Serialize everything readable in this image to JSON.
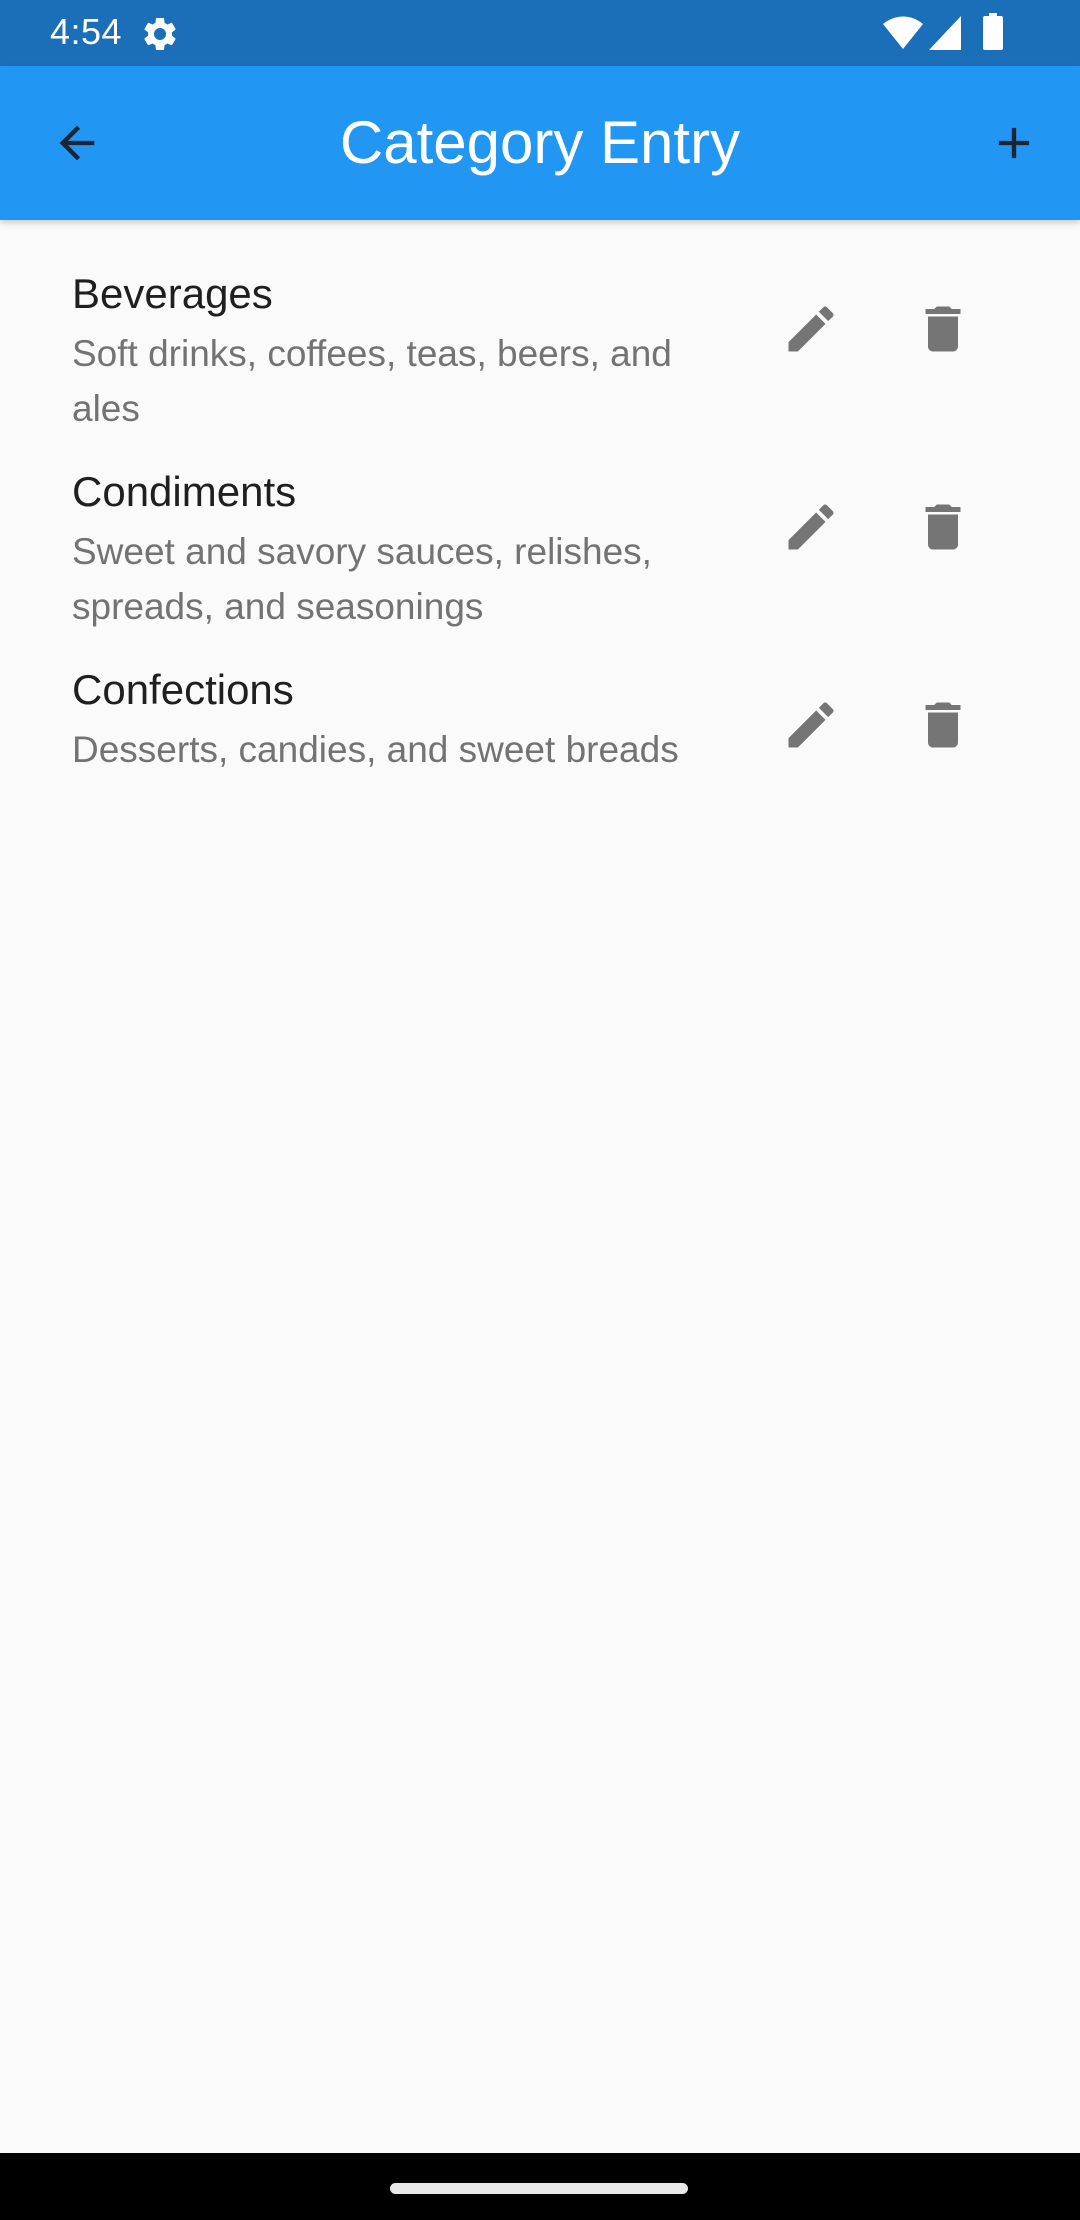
{
  "status_bar": {
    "time": "4:54",
    "icons": [
      "settings-gear-icon",
      "wifi-icon",
      "cellular-signal-icon",
      "battery-icon"
    ]
  },
  "app_bar": {
    "title": "Category Entry",
    "back_icon": "arrow-back-icon",
    "add_icon": "add-icon",
    "color": "#2196f3"
  },
  "categories": [
    {
      "name": "Beverages",
      "description": "Soft drinks, coffees, teas, beers, and ales",
      "actions": [
        "edit-icon",
        "delete-icon"
      ]
    },
    {
      "name": "Condiments",
      "description": "Sweet and savory sauces, relishes, spreads, and seasonings",
      "actions": [
        "edit-icon",
        "delete-icon"
      ]
    },
    {
      "name": "Confections",
      "description": "Desserts, candies, and sweet breads",
      "actions": [
        "edit-icon",
        "delete-icon"
      ]
    }
  ],
  "colors": {
    "status_bar": "#1b6fb8",
    "background": "#fafafa",
    "icon_gray": "#757575"
  }
}
